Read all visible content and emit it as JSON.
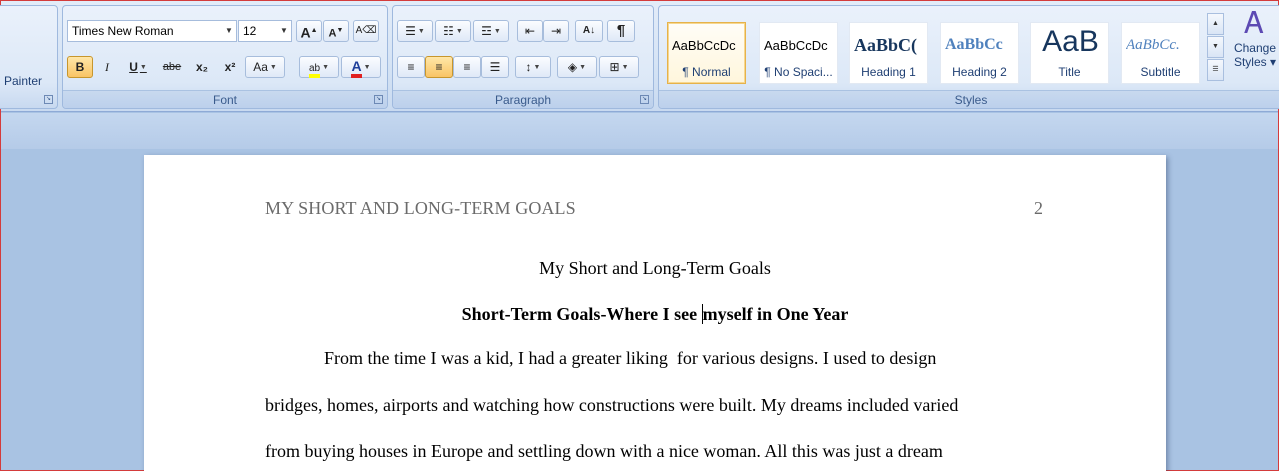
{
  "ribbon": {
    "clipboard": {
      "painter_label": "Painter"
    },
    "font": {
      "label": "Font",
      "font_name": "Times New Roman",
      "font_size": "12",
      "grow_label": "A",
      "shrink_label": "A",
      "bold_label": "B",
      "italic_label": "I",
      "underline_label": "U",
      "strike_label": "abe",
      "subscript_label": "x₂",
      "superscript_label": "x²",
      "case_label": "Aa",
      "highlight_label": "ab",
      "font_color_label": "A",
      "highlight_color": "#ffff00",
      "font_color": "#e02020"
    },
    "paragraph": {
      "label": "Paragraph",
      "sort_label": "A↓",
      "pilcrow_label": "¶"
    },
    "styles": {
      "label": "Styles",
      "items": [
        {
          "preview": "AaBbCcDc",
          "name": "¶ Normal",
          "selected": true
        },
        {
          "preview": "AaBbCcDc",
          "name": "¶ No Spaci..."
        },
        {
          "preview": "AaBbC(",
          "name": "Heading 1"
        },
        {
          "preview": "AaBbCc",
          "name": "Heading 2"
        },
        {
          "preview": "AaB",
          "name": "Title"
        },
        {
          "preview": "AaBbCc.",
          "name": "Subtitle"
        }
      ],
      "change_styles_line1": "Change",
      "change_styles_line2": "Styles ▾"
    }
  },
  "document": {
    "running_head": "MY SHORT AND LONG-TERM GOALS",
    "page_number": "2",
    "title": "My Short and Long-Term Goals",
    "heading_before_caret": "Short-Term Goals-Where I see ",
    "heading_after_caret": "myself in One Year",
    "paragraph_lines": [
      "From the time I was a kid, I had a greater liking  for various designs. I used to design",
      "bridges, homes, airports and watching how constructions were built. My dreams included varied",
      "from buying houses in Europe and settling down with a nice woman. All this was just a dream"
    ]
  }
}
